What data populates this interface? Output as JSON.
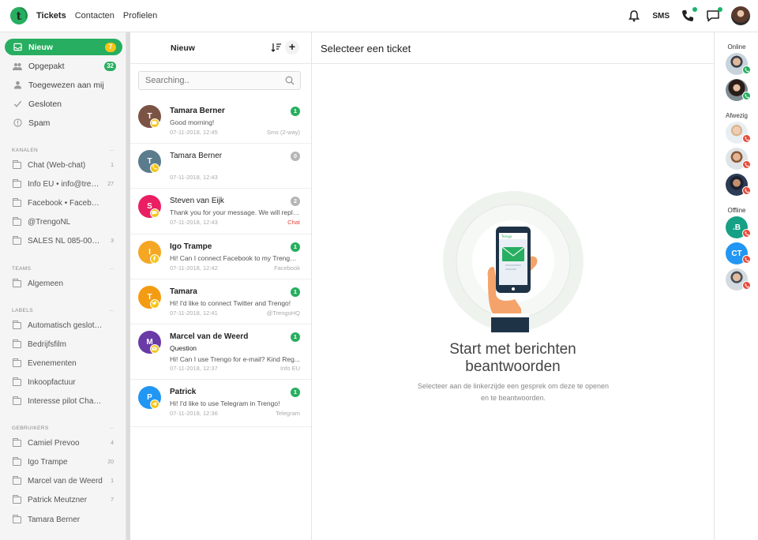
{
  "topbar": {
    "nav": [
      "Tickets",
      "Contacten",
      "Profielen"
    ],
    "sms_label": "SMS"
  },
  "sidebar": {
    "main_items": [
      {
        "label": "Nieuw",
        "count": "7",
        "icon": "inbox-icon",
        "active": true
      },
      {
        "label": "Opgepakt",
        "count": "32",
        "icon": "users-icon"
      },
      {
        "label": "Toegewezen aan mij",
        "count": "",
        "icon": "user-icon"
      },
      {
        "label": "Gesloten",
        "count": "",
        "icon": "check-icon"
      },
      {
        "label": "Spam",
        "count": "",
        "icon": "warning-icon"
      }
    ],
    "sections": [
      {
        "title": "KANALEN",
        "more": "...",
        "items": [
          {
            "label": "Chat (Web-chat)",
            "count": "1"
          },
          {
            "label": "Info EU • info@trengo...",
            "count": "27"
          },
          {
            "label": "Facebook • Facebook",
            "count": ""
          },
          {
            "label": "@TrengoNL",
            "count": ""
          },
          {
            "label": "SALES NL 085-001 3...",
            "count": "3"
          }
        ]
      },
      {
        "title": "TEAMS",
        "more": "...",
        "items": [
          {
            "label": "Algemeen",
            "count": ""
          }
        ]
      },
      {
        "title": "LABELS",
        "more": "...",
        "items": [
          {
            "label": "Automatisch gesloten",
            "count": ""
          },
          {
            "label": "Bedrijfsfilm",
            "count": ""
          },
          {
            "label": "Evenementen",
            "count": ""
          },
          {
            "label": "Inkoopfactuur",
            "count": ""
          },
          {
            "label": "Interesse pilot Chatb...",
            "count": ""
          }
        ]
      },
      {
        "title": "GEBRUIKERS",
        "more": "...",
        "items": [
          {
            "label": "Camiel Prevoo",
            "count": "4"
          },
          {
            "label": "Igo Trampe",
            "count": "20"
          },
          {
            "label": "Marcel van de Weerd",
            "count": "1"
          },
          {
            "label": "Patrick Meutzner",
            "count": "7"
          },
          {
            "label": "Tamara Berner",
            "count": ""
          }
        ]
      }
    ]
  },
  "list": {
    "title": "Nieuw",
    "add_label": "+",
    "search_placeholder": "Searching..",
    "tickets": [
      {
        "initial": "T",
        "name": "Tamara Berner",
        "bold": true,
        "subject": "",
        "preview": "Good morning!",
        "time": "07-11-2018, 12:45",
        "source": "Sms (2-way)",
        "count": "1",
        "count_color": "#27ae60",
        "avatar_color": "#7b5345",
        "channel_color": "#f5c518",
        "channel_icon": "sms-icon"
      },
      {
        "initial": "T",
        "name": "Tamara Berner",
        "bold": false,
        "subject": "",
        "preview": "",
        "time": "07-11-2018, 12:43",
        "source": "",
        "count": "0",
        "count_color": "#b5b5b5",
        "avatar_color": "#5a7c8c",
        "channel_color": "#f5c518",
        "channel_icon": "phone-icon"
      },
      {
        "initial": "S",
        "name": "Steven van Eijk",
        "bold": false,
        "subject": "",
        "preview": "Thank you for your message. We will reply...",
        "time": "07-11-2018, 12:43",
        "source": "Chat",
        "source_red": true,
        "count": "2",
        "count_color": "#b5b5b5",
        "avatar_color": "#e91e63",
        "channel_color": "#f5c518",
        "channel_icon": "chat-icon"
      },
      {
        "initial": "I",
        "name": "Igo Trampe",
        "bold": true,
        "subject": "",
        "preview": "Hi! Can I connect Facebook to my Trengo-...",
        "time": "07-11-2018, 12:42",
        "source": "Facebook",
        "count": "1",
        "count_color": "#27ae60",
        "avatar_color": "#f5a623",
        "channel_color": "#f5c518",
        "channel_icon": "facebook-icon"
      },
      {
        "initial": "T",
        "name": "Tamara",
        "bold": true,
        "subject": "",
        "preview": "Hi! I'd like to connect Twitter and Trengo!",
        "time": "07-11-2018, 12:41",
        "source": "@TrengoHQ",
        "count": "1",
        "count_color": "#27ae60",
        "avatar_color": "#f39c12",
        "channel_color": "#f5c518",
        "channel_icon": "twitter-icon"
      },
      {
        "initial": "M",
        "name": "Marcel van de Weerd",
        "bold": true,
        "subject": "Question",
        "preview": "Hi! Can I use Trengo for e-mail? Kind Reg...",
        "time": "07-11-2018, 12:37",
        "source": "Info EU",
        "count": "1",
        "count_color": "#27ae60",
        "avatar_color": "#6a3aa7",
        "channel_color": "#f5c518",
        "channel_icon": "email-icon"
      },
      {
        "initial": "P",
        "name": "Patrick",
        "bold": true,
        "subject": "",
        "preview": "Hi! I'd like to use Telegram in Trengo!",
        "time": "07-11-2018, 12:36",
        "source": "Telegram",
        "count": "1",
        "count_color": "#27ae60",
        "avatar_color": "#2196f3",
        "channel_color": "#f5c518",
        "channel_icon": "telegram-icon"
      }
    ]
  },
  "main": {
    "title": "Selecteer een ticket",
    "empty_title_1": "Start met berichten",
    "empty_title_2": "beantwoorden",
    "empty_sub_1": "Selecteer aan de linkerzijde een gesprek om deze te openen",
    "empty_sub_2": "en te beantwoorden.",
    "phone_brand": "Trengo"
  },
  "users": {
    "sections": [
      {
        "title": "Online",
        "users": [
          {
            "initials": "",
            "photo": "man-suit",
            "status": "online"
          },
          {
            "initials": "",
            "photo": "woman-dark-hair",
            "status": "online"
          }
        ]
      },
      {
        "title": "Afwezig",
        "users": [
          {
            "initials": "",
            "photo": "man-light",
            "status": "away"
          },
          {
            "initials": "",
            "photo": "man-beard",
            "status": "away"
          },
          {
            "initials": "",
            "photo": "man-dark",
            "status": "away"
          }
        ]
      },
      {
        "title": "Offline",
        "users": [
          {
            "initials": ".B",
            "bg": "#16a085",
            "status": "offline"
          },
          {
            "initials": "CT",
            "bg": "#2196f3",
            "status": "offline"
          },
          {
            "initials": "",
            "photo": "man-suit-2",
            "status": "offline"
          }
        ]
      }
    ]
  },
  "colors": {
    "accent": "#27ae60",
    "online": "#27ae60",
    "away": "#e74c3c",
    "offline": "#e74c3c"
  }
}
